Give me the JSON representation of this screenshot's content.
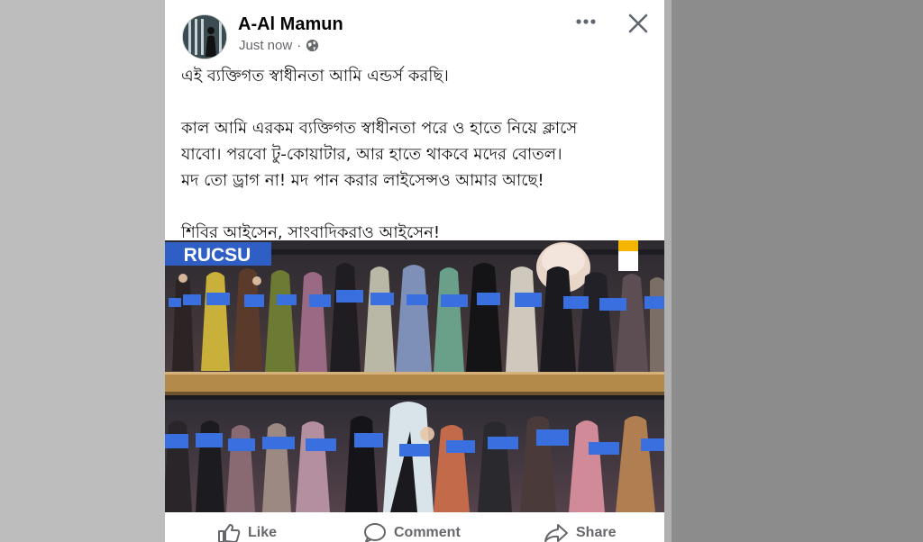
{
  "post": {
    "author": "A-Al Mamun",
    "timestamp": "Just now",
    "separator": "·",
    "privacy_icon": "globe-icon",
    "text": {
      "line1": "এই ব্যক্তিগত স্বাধীনতা আমি এন্ডর্স করছি।",
      "para2_line1": "কাল আমি এরকম ব্যক্তিগত স্বাধীনতা পরে ও হাতে নিয়ে ক্লাসে",
      "para2_line2": "যাবো। পরবো টু-কোয়াটার, আর হাতে থাকবে মদের বোতল।",
      "para2_line3": "মদ তো ড্রাগ না! মদ পান করার লাইসেন্সও আমার আছে!",
      "para3": "শিবির আইসেন, সাংবাদিকরাও আইসেন!"
    },
    "photo": {
      "badge": "RUCSU"
    }
  },
  "actions": {
    "like": "Like",
    "comment": "Comment",
    "share": "Share"
  },
  "colors": {
    "badge_bg": "#2f5fc4",
    "folder_blue": "#3a6fe0",
    "stage_wood": "#b48a4a",
    "accent_yellow": "#f5b400"
  }
}
